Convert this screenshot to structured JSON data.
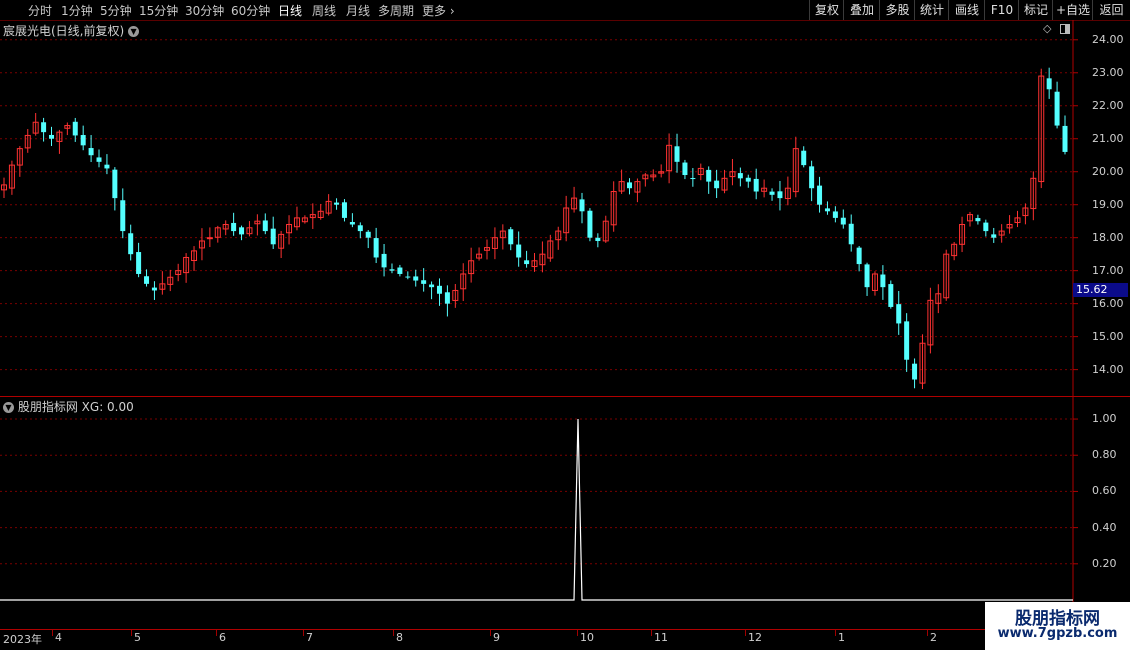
{
  "toolbar": {
    "periods": [
      "分时",
      "1分钟",
      "5分钟",
      "15分钟",
      "30分钟",
      "60分钟",
      "日线",
      "周线",
      "月线",
      "多周期",
      "更多"
    ],
    "active_period": "日线",
    "right_buttons": [
      "复权",
      "叠加",
      "多股",
      "统计",
      "画线",
      "F10",
      "标记",
      "+自选",
      "返回"
    ]
  },
  "main_panel": {
    "title": "宸展光电(日线,前复权)",
    "current_price_tag": "15.62",
    "icons": [
      "diamond-icon",
      "layout-toggle-icon"
    ]
  },
  "indicator_panel": {
    "title": "股朋指标网",
    "value_text": "XG: 0.00"
  },
  "x_axis": {
    "labels": [
      "2023年",
      "4",
      "5",
      "6",
      "7",
      "8",
      "9",
      "10",
      "11",
      "12",
      "1",
      "2"
    ]
  },
  "watermark": {
    "title": "股朋指标网",
    "url": "www.7gpzb.com"
  },
  "colors": {
    "up": "#ff3232",
    "down": "#54ffff",
    "grid": "#7a0000",
    "axis_line": "#b00000",
    "indicator_line": "#ffffff"
  },
  "chart_data": [
    {
      "type": "candlestick",
      "title": "宸展光电(日线,前复权)",
      "y_ticks": [
        "24.00",
        "23.00",
        "22.00",
        "21.00",
        "20.00",
        "19.00",
        "18.00",
        "17.00",
        "16.00",
        "15.00",
        "14.00"
      ],
      "ylim": [
        13.2,
        24.6
      ],
      "x_categories": [
        "2023年",
        "4",
        "5",
        "6",
        "7",
        "8",
        "9",
        "10",
        "11",
        "12",
        "1",
        "2"
      ],
      "close_series": [
        19.6,
        20.2,
        20.7,
        21.1,
        21.5,
        21.2,
        21.0,
        21.2,
        21.4,
        21.1,
        20.8,
        20.5,
        20.3,
        20.1,
        19.2,
        18.2,
        17.5,
        16.9,
        16.6,
        16.4,
        16.6,
        16.8,
        17.0,
        17.4,
        17.6,
        17.9,
        18.0,
        18.3,
        18.4,
        18.2,
        18.1,
        18.3,
        18.5,
        18.2,
        17.8,
        18.1,
        18.4,
        18.6,
        18.6,
        18.7,
        18.8,
        19.1,
        19.0,
        18.6,
        18.4,
        18.2,
        18.0,
        17.4,
        17.1,
        17.0,
        16.9,
        16.8,
        16.7,
        16.6,
        16.5,
        16.3,
        16.0,
        16.4,
        16.9,
        17.3,
        17.5,
        17.7,
        18.0,
        18.2,
        17.8,
        17.4,
        17.2,
        17.3,
        17.5,
        17.9,
        18.2,
        18.9,
        19.2,
        18.8,
        18.0,
        17.9,
        18.5,
        19.4,
        19.7,
        19.5,
        19.7,
        19.9,
        19.9,
        20.0,
        20.8,
        20.3,
        19.9,
        19.8,
        20.1,
        19.7,
        19.5,
        19.8,
        20.0,
        19.8,
        19.7,
        19.4,
        19.5,
        19.3,
        19.2,
        19.5,
        20.7,
        20.2,
        19.5,
        19.0,
        18.8,
        18.6,
        18.4,
        17.8,
        17.2,
        16.5,
        16.9,
        16.5,
        15.9,
        15.4,
        14.3,
        13.7,
        14.8,
        16.1,
        16.3,
        17.5,
        17.8,
        18.4,
        18.7,
        18.5,
        18.2,
        18.0,
        18.2,
        18.4,
        18.6,
        18.9,
        19.8,
        22.9,
        22.5,
        21.4,
        20.6
      ]
    },
    {
      "type": "line",
      "title": "股朋指标网",
      "series": [
        {
          "name": "XG",
          "last_value": 0.0
        }
      ],
      "y_ticks": [
        "1.00",
        "0.80",
        "0.60",
        "0.40",
        "0.20"
      ],
      "ylim": [
        0,
        1.05
      ],
      "signal_month": "10",
      "signal_value": 1.0
    }
  ]
}
